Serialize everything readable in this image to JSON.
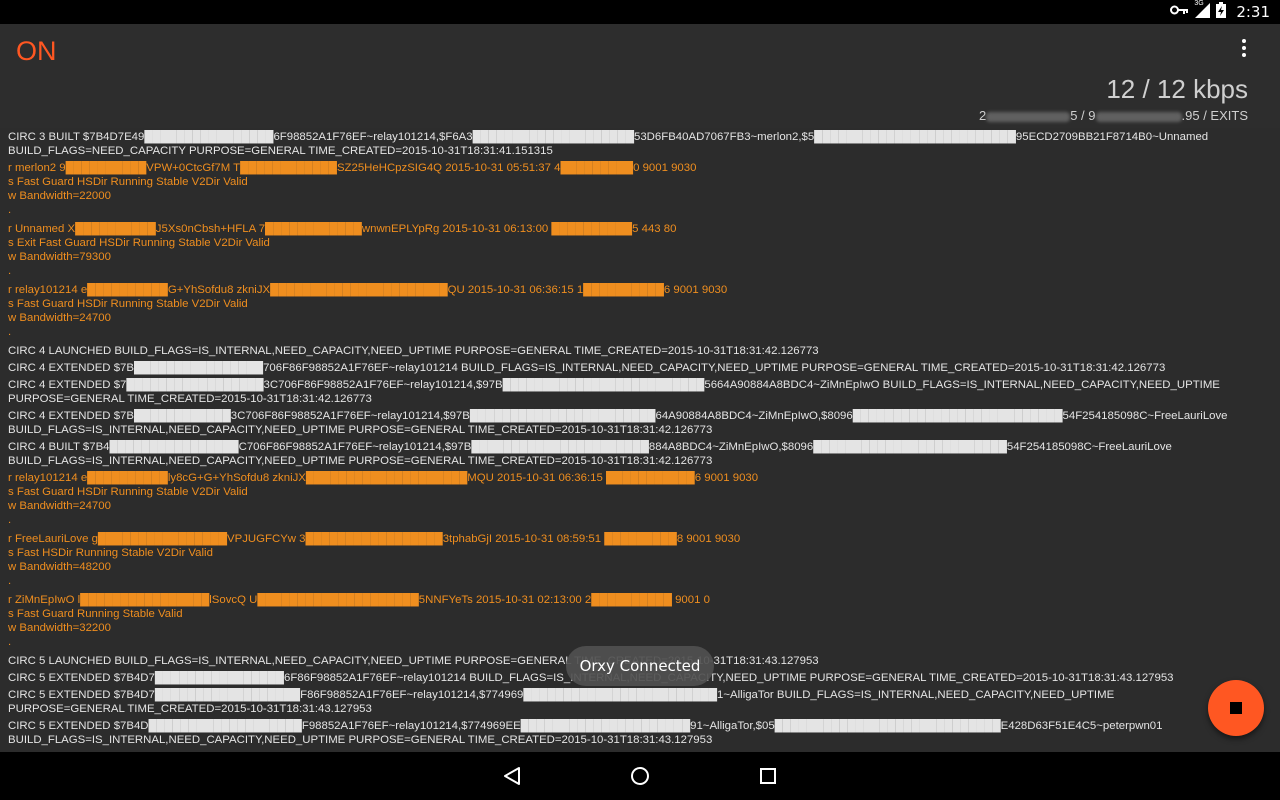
{
  "statusbar": {
    "clock": "2:31",
    "network_label": "3G",
    "icons": [
      "vpn-key-icon",
      "signal-3g-icon",
      "battery-charging-icon"
    ]
  },
  "app": {
    "status": "ON",
    "status_color": "#ff5722",
    "bandwidth": "12 / 12 kbps",
    "nodes_prefix": "2",
    "nodes_mid_a": "5 / 9",
    "nodes_suffix": ".95 / EXITS"
  },
  "log": [
    {
      "type": "circ",
      "text": "CIRC 3 BUILT $7B4D7E49████████████████6F98852A1F76EF~relay101214,$F6A3████████████████████53D6FB40AD7067FB3~merlon2,$5█████████████████████████95ECD2709BB21F8714B0~Unnamed\nBUILD_FLAGS=NEED_CAPACITY PURPOSE=GENERAL TIME_CREATED=2015-10-31T18:31:41.151315"
    },
    {
      "type": "relay",
      "text": "r merlon2 9██████████VPW+0CtcGf7M T████████████SZ25HeHCpzSIG4Q 2015-10-31 05:51:37 4█████████0 9001 9030\ns Fast Guard HSDir Running Stable V2Dir Valid\nw Bandwidth=22000\n."
    },
    {
      "type": "relay",
      "text": "r Unnamed X██████████J5Xs0nCbsh+HFLA 7████████████wnwnEPLYpRg 2015-10-31 06:13:00 ██████████5 443 80\ns Exit Fast Guard HSDir Running Stable V2Dir Valid\nw Bandwidth=79300\n."
    },
    {
      "type": "relay",
      "text": "r relay101214 e██████████G+YhSofdu8 zkniJX██████████████████████QU 2015-10-31 06:36:15 1██████████6 9001 9030\ns Fast Guard HSDir Running Stable V2Dir Valid\nw Bandwidth=24700\n."
    },
    {
      "type": "circ",
      "text": "CIRC 4 LAUNCHED BUILD_FLAGS=IS_INTERNAL,NEED_CAPACITY,NEED_UPTIME PURPOSE=GENERAL TIME_CREATED=2015-10-31T18:31:42.126773"
    },
    {
      "type": "circ",
      "text": "CIRC 4 EXTENDED $7B████████████████706F86F98852A1F76EF~relay101214 BUILD_FLAGS=IS_INTERNAL,NEED_CAPACITY,NEED_UPTIME PURPOSE=GENERAL TIME_CREATED=2015-10-31T18:31:42.126773"
    },
    {
      "type": "circ",
      "text": "CIRC 4 EXTENDED $7█████████████████3C706F86F98852A1F76EF~relay101214,$97B█████████████████████████5664A90884A8BDC4~ZiMnEpIwO BUILD_FLAGS=IS_INTERNAL,NEED_CAPACITY,NEED_UPTIME\nPURPOSE=GENERAL TIME_CREATED=2015-10-31T18:31:42.126773"
    },
    {
      "type": "circ",
      "text": "CIRC 4 EXTENDED $7B████████████3C706F86F98852A1F76EF~relay101214,$97B███████████████████████64A90884A8BDC4~ZiMnEpIwO,$8096██████████████████████████54F254185098C~FreeLauriLove\nBUILD_FLAGS=IS_INTERNAL,NEED_CAPACITY,NEED_UPTIME PURPOSE=GENERAL TIME_CREATED=2015-10-31T18:31:42.126773"
    },
    {
      "type": "circ",
      "text": "CIRC 4 BUILT $7B4████████████████C706F86F98852A1F76EF~relay101214,$97B██████████████████████884A8BDC4~ZiMnEpIwO,$8096████████████████████████54F254185098C~FreeLauriLove\nBUILD_FLAGS=IS_INTERNAL,NEED_CAPACITY,NEED_UPTIME PURPOSE=GENERAL TIME_CREATED=2015-10-31T18:31:42.126773"
    },
    {
      "type": "relay",
      "text": "r relay101214 e██████████ly8cG+G+YhSofdu8 zkniJX████████████████████MQU 2015-10-31 06:36:15 ███████████6 9001 9030\ns Fast Guard HSDir Running Stable V2Dir Valid\nw Bandwidth=24700\n."
    },
    {
      "type": "relay",
      "text": "r FreeLauriLove g████████████████VPJUGFCYw 3█████████████████3tphabGjI 2015-10-31 08:59:51 █████████8 9001 9030\ns Fast HSDir Running Stable V2Dir Valid\nw Bandwidth=48200\n."
    },
    {
      "type": "relay",
      "text": "r ZiMnEpIwO l████████████████lSovcQ U████████████████████5NNFYeTs 2015-10-31 02:13:00 2██████████ 9001 0\ns Fast Guard Running Stable Valid\nw Bandwidth=32200\n."
    },
    {
      "type": "circ",
      "text": "CIRC 5 LAUNCHED BUILD_FLAGS=IS_INTERNAL,NEED_CAPACITY,NEED_UPTIME PURPOSE=GENERAL TIME_CREATED=2015-10-31T18:31:43.127953"
    },
    {
      "type": "circ",
      "text": "CIRC 5 EXTENDED $7B4D7████████████████6F86F98852A1F76EF~relay101214 BUILD_FLAGS=IS_INTERNAL,NEED_CAPACITY,NEED_UPTIME PURPOSE=GENERAL TIME_CREATED=2015-10-31T18:31:43.127953"
    },
    {
      "type": "circ",
      "text": "CIRC 5 EXTENDED $7B4D7██████████████████F86F98852A1F76EF~relay101214,$774969████████████████████████1~AlligaTor BUILD_FLAGS=IS_INTERNAL,NEED_CAPACITY,NEED_UPTIME\nPURPOSE=GENERAL TIME_CREATED=2015-10-31T18:31:43.127953"
    },
    {
      "type": "circ",
      "text": "CIRC 5 EXTENDED $7B4D███████████████████F98852A1F76EF~relay101214,$774969EE█████████████████████91~AlligaTor,$05████████████████████████████E428D63F51E4C5~peterpwn01\nBUILD_FLAGS=IS_INTERNAL,NEED_CAPACITY,NEED_UPTIME PURPOSE=GENERAL TIME_CREATED=2015-10-31T18:31:43.127953"
    }
  ],
  "toast": "Orxy Connected",
  "fab": {
    "icon": "stop-icon",
    "color": "#ff5722"
  },
  "navbar": {
    "icons": [
      "back-icon",
      "home-icon",
      "recents-icon"
    ]
  }
}
